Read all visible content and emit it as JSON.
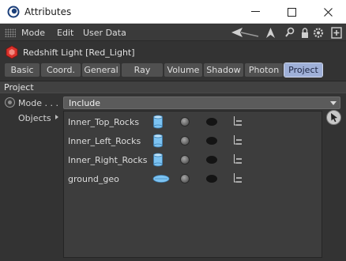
{
  "window": {
    "title": "Attributes"
  },
  "menu": {
    "items": [
      "Mode",
      "Edit",
      "User Data"
    ]
  },
  "object": {
    "title": "Redshift Light [Red_Light]"
  },
  "tabs": [
    {
      "label": "Basic",
      "active": false
    },
    {
      "label": "Coord.",
      "active": false
    },
    {
      "label": "General",
      "active": false
    },
    {
      "label": "Ray",
      "active": false
    },
    {
      "label": "Volume",
      "active": false
    },
    {
      "label": "Shadow",
      "active": false
    },
    {
      "label": "Photon",
      "active": false
    },
    {
      "label": "Project",
      "active": true
    }
  ],
  "section": {
    "title": "Project"
  },
  "mode": {
    "label": "Mode . . .",
    "value": "Include"
  },
  "objects": {
    "label": "Objects",
    "rows": [
      {
        "name": "Inner_Top_Rocks",
        "icon": "cylinder-icon"
      },
      {
        "name": "Inner_Left_Rocks",
        "icon": "cylinder-icon"
      },
      {
        "name": "Inner_Right_Rocks",
        "icon": "cylinder-icon"
      },
      {
        "name": "ground_geo",
        "icon": "disc-icon"
      }
    ]
  },
  "colors": {
    "accent_tab": "#9fb0d8",
    "background": "#333333",
    "list_bg": "#3d3d3d",
    "object_icon": "#d9312b"
  }
}
